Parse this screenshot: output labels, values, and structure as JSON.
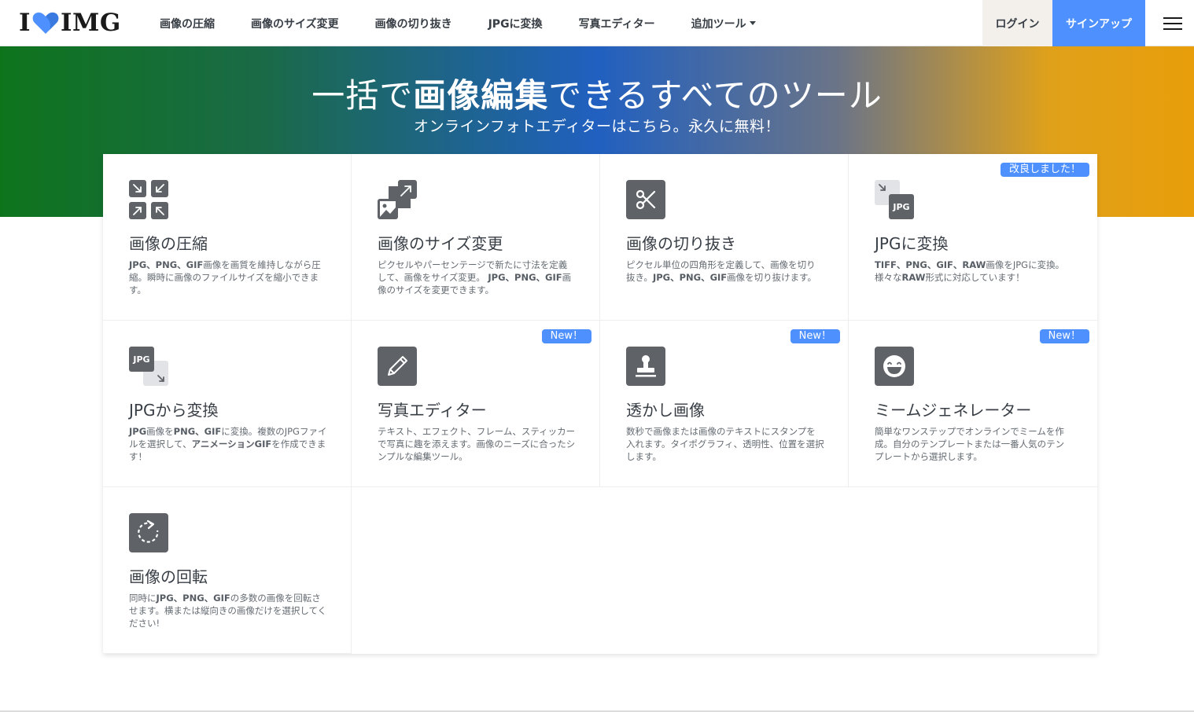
{
  "brand": {
    "logo_left": "I",
    "logo_right": "IMG",
    "heart_color": "#4d90fe"
  },
  "nav": {
    "items": [
      {
        "label": "画像の圧縮"
      },
      {
        "label": "画像のサイズ変更"
      },
      {
        "label": "画像の切り抜き"
      },
      {
        "label": "JPGに変換"
      },
      {
        "label": "写真エディター"
      },
      {
        "label": "追加ツール"
      }
    ],
    "login": "ログイン",
    "signup": "サインアップ",
    "menu_icon": "hamburger-icon"
  },
  "hero": {
    "title_pre": "一括で",
    "title_bold": "画像編集",
    "title_post": "できるすべてのツール",
    "subtitle": "オンラインフォトエディターはこちら。永久に無料！"
  },
  "tools": [
    {
      "title": "画像の圧縮",
      "icon": "compress-icon",
      "badge": "",
      "desc": [
        {
          "t": "JPG、PNG、GIF",
          "b": true
        },
        {
          "t": "画像を画質を維持しながら圧縮。瞬時に画像のファイルサイズを縮小できます。",
          "b": false
        }
      ]
    },
    {
      "title": "画像のサイズ変更",
      "icon": "resize-icon",
      "badge": "",
      "desc": [
        {
          "t": "ピクセルやパーセンテージで新たに寸法を定義して、画像をサイズ変更。 ",
          "b": false
        },
        {
          "t": "JPG、PNG、GIF",
          "b": true
        },
        {
          "t": "画像のサイズを変更できます。",
          "b": false
        }
      ]
    },
    {
      "title": "画像の切り抜き",
      "icon": "scissors-icon",
      "badge": "",
      "desc": [
        {
          "t": "ピクセル単位の四角形を定義して、画像を切り抜き。",
          "b": false
        },
        {
          "t": "JPG、PNG、GIF",
          "b": true
        },
        {
          "t": "画像を切り抜けます。",
          "b": false
        }
      ]
    },
    {
      "title": "JPGに変換",
      "icon": "to-jpg-icon",
      "badge": "改良しました！",
      "desc": [
        {
          "t": "TIFF、PNG、GIF、RAW",
          "b": true
        },
        {
          "t": "画像をJPGに変換。様々な",
          "b": false
        },
        {
          "t": "RAW",
          "b": true
        },
        {
          "t": "形式に対応しています！",
          "b": false
        }
      ]
    },
    {
      "title": "JPGから変換",
      "icon": "from-jpg-icon",
      "badge": "",
      "desc": [
        {
          "t": "JPG",
          "b": true
        },
        {
          "t": "画像を",
          "b": false
        },
        {
          "t": "PNG、GIF",
          "b": true
        },
        {
          "t": "に変換。複数のJPGファイルを選択して、",
          "b": false
        },
        {
          "t": "アニメーションGIF",
          "b": true
        },
        {
          "t": "を作成できます！",
          "b": false
        }
      ]
    },
    {
      "title": "写真エディター",
      "icon": "pencil-icon",
      "badge": "New！",
      "desc": [
        {
          "t": "テキスト、エフェクト、フレーム、スティッカーで写真に趣を添えます。画像のニーズに合ったシンプルな編集ツール。",
          "b": false
        }
      ]
    },
    {
      "title": "透かし画像",
      "icon": "stamp-icon",
      "badge": "New！",
      "desc": [
        {
          "t": "数秒で画像または画像のテキストにスタンプを入れます。タイポグラフィ、透明性、位置を選択します。",
          "b": false
        }
      ]
    },
    {
      "title": "ミームジェネレーター",
      "icon": "laugh-icon",
      "badge": "New！",
      "desc": [
        {
          "t": "簡単なワンステップでオンラインでミームを作成。自分のテンプレートまたは一番人気のテンプレートから選択します。",
          "b": false
        }
      ]
    },
    {
      "title": "画像の回転",
      "icon": "rotate-icon",
      "badge": "",
      "desc": [
        {
          "t": "同時に",
          "b": false
        },
        {
          "t": "JPG、PNG、GIF",
          "b": true
        },
        {
          "t": "の多数の画像を回転させます。横または縦向きの画像だけを選択してください!",
          "b": false
        }
      ]
    }
  ],
  "icon_labels": {
    "jpg": "JPG"
  },
  "colors": {
    "accent": "#4d90fe",
    "icon_bg": "#5f6368",
    "text": "#383e45"
  }
}
